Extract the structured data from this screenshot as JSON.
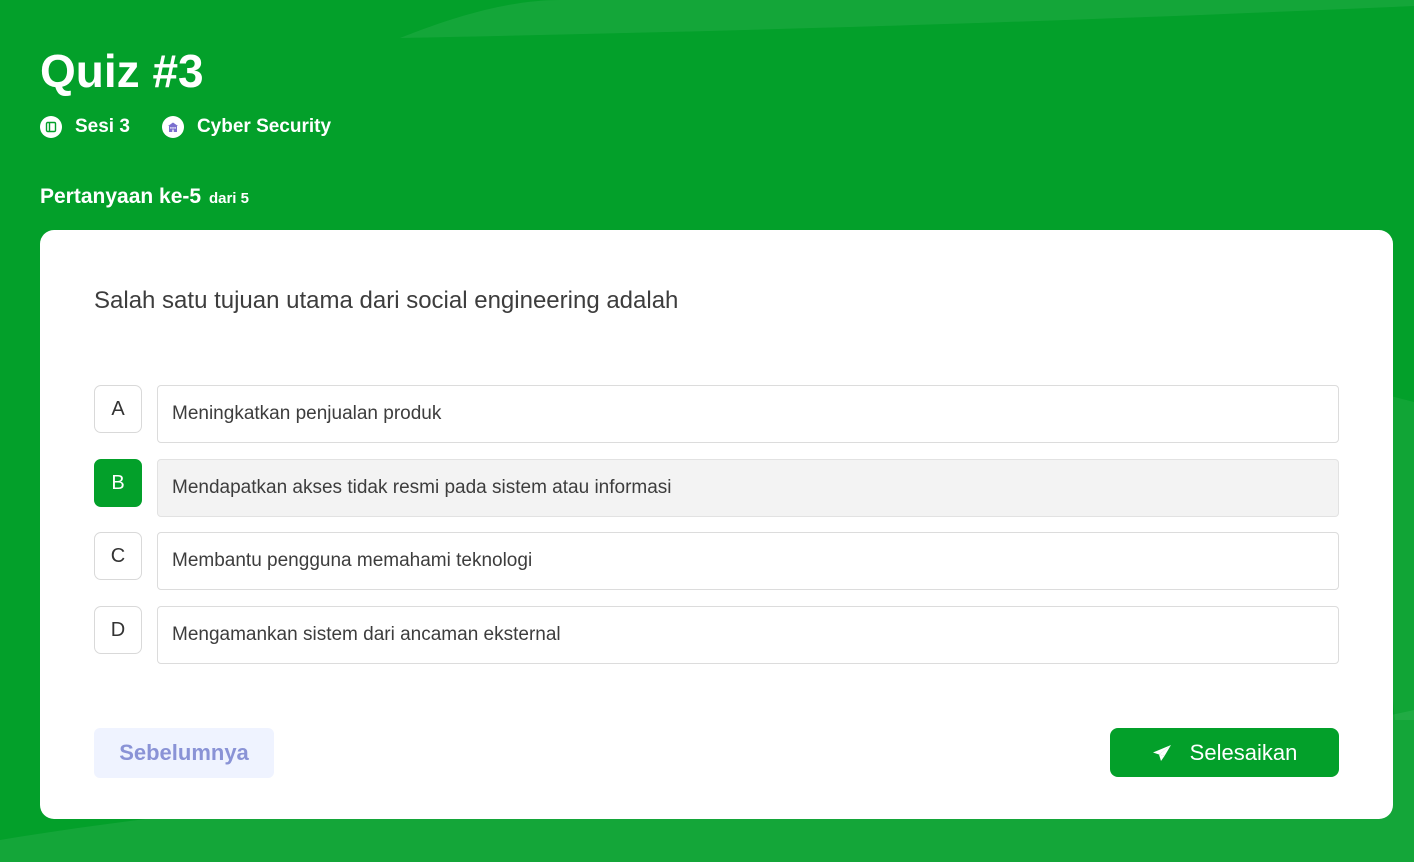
{
  "quiz": {
    "title": "Quiz #3",
    "session_label": "Sesi 3",
    "course_label": "Cyber Security"
  },
  "progress": {
    "label": "Pertanyaan ke-5",
    "suffix": "dari 5",
    "current": 5,
    "total": 5
  },
  "question": {
    "text": "Salah satu tujuan utama dari social engineering adalah"
  },
  "options": [
    {
      "letter": "A",
      "text": "Meningkatkan penjualan produk",
      "selected": false
    },
    {
      "letter": "B",
      "text": "Mendapatkan akses tidak resmi pada sistem atau informasi",
      "selected": true
    },
    {
      "letter": "C",
      "text": "Membantu pengguna memahami teknologi",
      "selected": false
    },
    {
      "letter": "D",
      "text": "Mengamankan sistem dari ancaman eksternal",
      "selected": false
    }
  ],
  "buttons": {
    "prev_label": "Sebelumnya",
    "finish_label": "Selesaikan"
  },
  "icons": {
    "session": "book-icon",
    "course": "building-icon",
    "finish": "send-icon"
  },
  "colors": {
    "brand_green": "#03a02a",
    "prev_button_bg": "#eff3ff",
    "prev_button_text": "#8a93d6"
  }
}
